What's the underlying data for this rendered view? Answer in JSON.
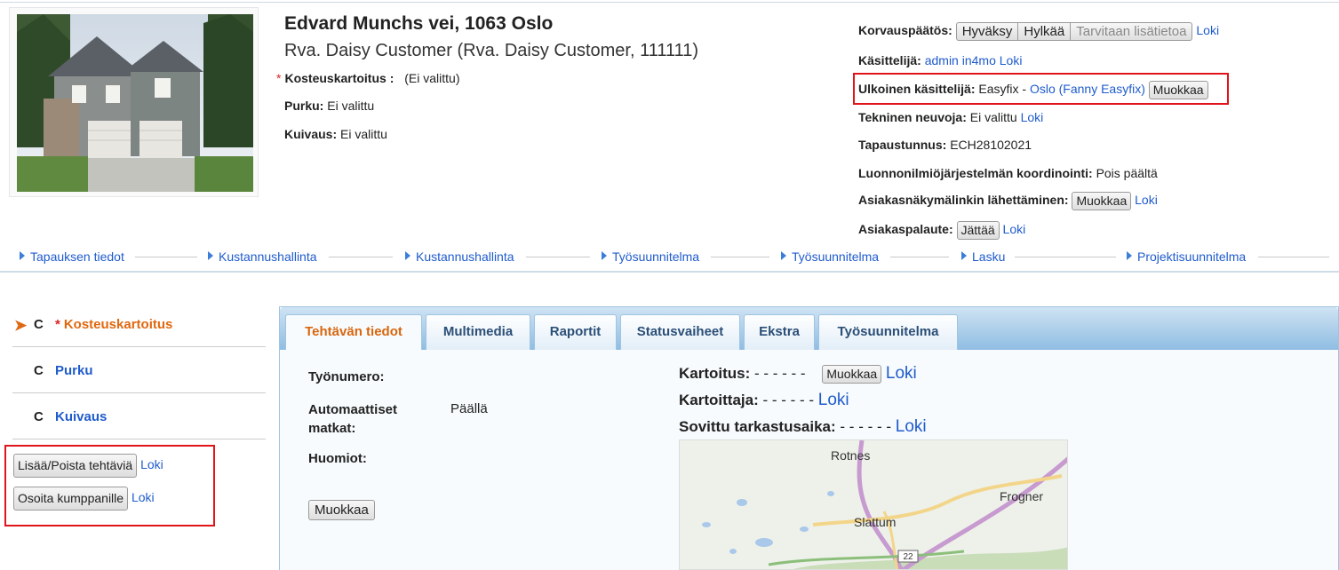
{
  "header": {
    "address": "Edvard Munchs vei, 1063 Oslo",
    "customer": "Rva. Daisy Customer (Rva. Daisy Customer, 111111)",
    "kosteuskartoitus_label": "Kosteuskartoitus :",
    "kosteuskartoitus_value": "(Ei valittu)",
    "purku_label": "Purku:",
    "purku_value": "Ei valittu",
    "kuivaus_label": "Kuivaus:",
    "kuivaus_value": "Ei valittu"
  },
  "info": {
    "korvauspaatos_label": "Korvauspäätös:",
    "hyvaksy": "Hyväksy",
    "hylkaa": "Hylkää",
    "lisatietoa": "Tarvitaan lisätietoa",
    "loki": "Loki",
    "kasittelija_label": "Käsittelijä:",
    "kasittelija_value": "admin in4mo",
    "ulkoinen_label": "Ulkoinen käsittelijä:",
    "ulkoinen_value": "Easyfix -",
    "ulkoinen_link": "Oslo (Fanny Easyfix)",
    "muokkaa": "Muokkaa",
    "tekninen_label": "Tekninen neuvoja:",
    "tekninen_value": "Ei valittu",
    "tapaustunnus_label": "Tapaustunnus:",
    "tapaustunnus_value": "ECH28102021",
    "luonnonilmio_label": "Luonnonilmiöjärjestelmän koordinointi:",
    "luonnonilmio_value": "Pois päältä",
    "asiakasnakyma_label": "Asiakasnäkymälinkin lähettäminen:",
    "asiakaspalaute_label": "Asiakaspalaute:",
    "jatta": "Jättää"
  },
  "nav": [
    "Tapauksen tiedot",
    "Kustannushallinta",
    "Kustannushallinta",
    "Työsuunnitelma",
    "Työsuunnitelma",
    "Lasku",
    "Projektisuunnitelma"
  ],
  "tasks": [
    {
      "c": "C",
      "required": "*",
      "name": "Kosteuskartoitus"
    },
    {
      "c": "C",
      "name": "Purku"
    },
    {
      "c": "C",
      "name": "Kuivaus"
    }
  ],
  "actions": {
    "add_remove": "Lisää/Poista tehtäviä",
    "assign": "Osoita kumppanille",
    "loki": "Loki"
  },
  "tabs": [
    "Tehtävän tiedot",
    "Multimedia",
    "Raportit",
    "Statusvaiheet",
    "Ekstra",
    "Työsuunnitelma"
  ],
  "details": {
    "tyonumero": "Työnumero:",
    "automaattiset": "Automaattiset matkat:",
    "automaattiset_value": "Päällä",
    "huomiot": "Huomiot:",
    "muokkaa": "Muokkaa",
    "kartoitus_label": "Kartoitus:",
    "kartoitus_value": "- - - - - -",
    "kartoittaja_label": "Kartoittaja:",
    "kartoittaja_value": "- - - - - -",
    "sovittu_label": "Sovittu tarkastusaika:",
    "sovittu_value": "- - - - - -",
    "loki": "Loki"
  },
  "map": {
    "labels": [
      "Rotnes",
      "Frogner",
      "Slattum"
    ],
    "road": "22"
  }
}
